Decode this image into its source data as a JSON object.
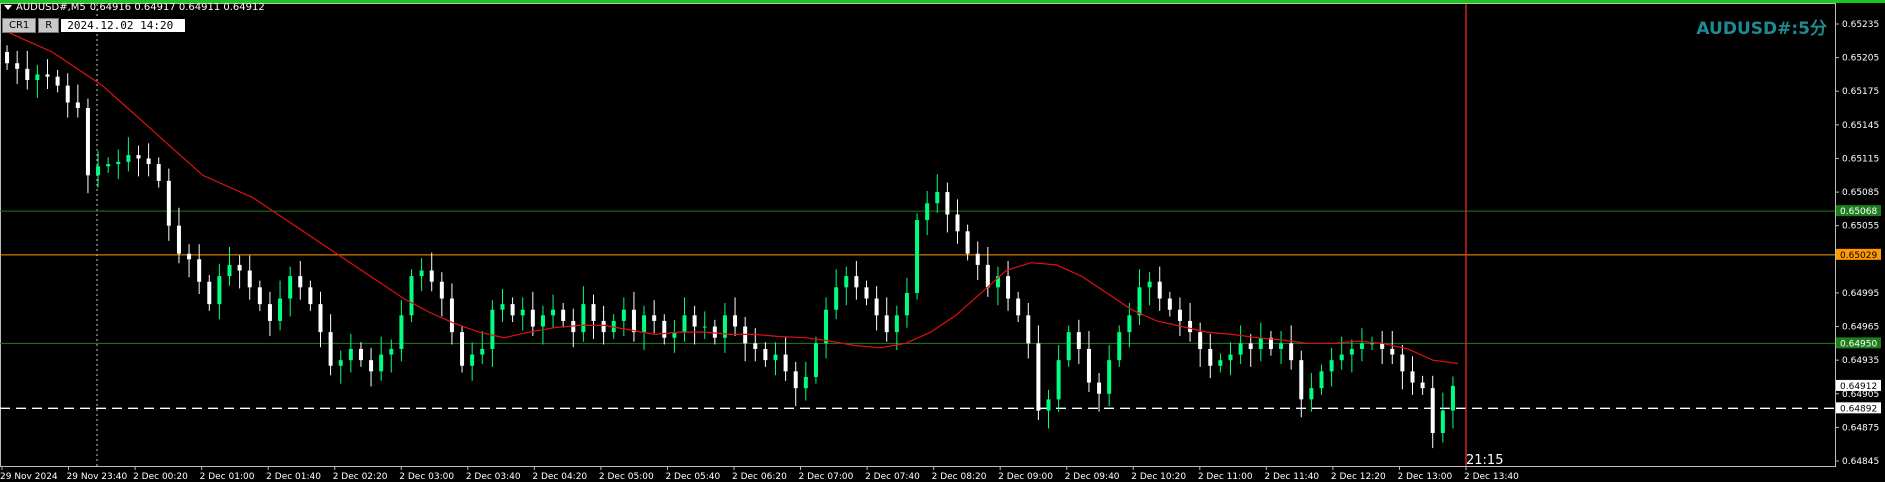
{
  "header": {
    "symbol_tf": "AUDUSD#,M5",
    "ohlc": "0.64916 0.64917 0.64911 0.64912"
  },
  "toolbar": {
    "btn1": "CR1",
    "btn2": "R",
    "datetime": "2024.12.02 14:20"
  },
  "watermark": "AUDUSD#:5分",
  "crosshair_time": "21:15",
  "colors": {
    "bg": "#000000",
    "bull": "#00ff7f",
    "bear": "#ffffff",
    "ma": "#ff2020",
    "hline_green": "#1e7e1e",
    "hline_orange": "#ff9900",
    "crosshair": "#ff2a2a"
  },
  "chart_data": {
    "type": "candlestick",
    "price_axis": {
      "min": 0.64845,
      "max": 0.65235,
      "ticks": [
        "0.65235",
        "0.65205",
        "0.65175",
        "0.65145",
        "0.65115",
        "0.65085",
        "0.65055",
        "0.64995",
        "0.64965",
        "0.64935",
        "0.64905",
        "0.64875",
        "0.64845"
      ]
    },
    "time_labels": [
      "29 Nov 2024",
      "29 Nov 23:40",
      "2 Dec 00:20",
      "2 Dec 01:00",
      "2 Dec 01:40",
      "2 Dec 02:20",
      "2 Dec 03:00",
      "2 Dec 03:40",
      "2 Dec 04:20",
      "2 Dec 05:00",
      "2 Dec 05:40",
      "2 Dec 06:20",
      "2 Dec 07:00",
      "2 Dec 07:40",
      "2 Dec 08:20",
      "2 Dec 09:00",
      "2 Dec 09:40",
      "2 Dec 10:20",
      "2 Dec 11:00",
      "2 Dec 11:40",
      "2 Dec 12:20",
      "2 Dec 13:00",
      "2 Dec 13:40"
    ],
    "horizontal_lines": [
      {
        "label": "0.65068",
        "price": 0.65068,
        "color": "#1e7e1e",
        "style": "solid"
      },
      {
        "label": "0.65029",
        "price": 0.65029,
        "color": "#ff9900",
        "style": "solid"
      },
      {
        "label": "0.64950",
        "price": 0.6495,
        "color": "#1e7e1e",
        "style": "solid"
      },
      {
        "label": "0.64892",
        "price": 0.64892,
        "color": "#ffffff",
        "style": "dashed"
      }
    ],
    "bid_label": "0.64912",
    "bid_price": 0.64912,
    "closes": [
      0.652,
      0.65195,
      0.65185,
      0.6519,
      0.65188,
      0.6518,
      0.65165,
      0.6516,
      0.651,
      0.65108,
      0.6511,
      0.65112,
      0.65118,
      0.65115,
      0.6511,
      0.65095,
      0.65055,
      0.6503,
      0.65025,
      0.65005,
      0.64985,
      0.6501,
      0.6502,
      0.65015,
      0.65,
      0.64985,
      0.6497,
      0.6499,
      0.6501,
      0.65,
      0.64985,
      0.6496,
      0.6493,
      0.64935,
      0.64945,
      0.64935,
      0.64925,
      0.6494,
      0.64945,
      0.64975,
      0.6501,
      0.65015,
      0.65005,
      0.6499,
      0.6496,
      0.6493,
      0.6494,
      0.64945,
      0.6498,
      0.64985,
      0.64975,
      0.6498,
      0.64965,
      0.64975,
      0.6498,
      0.6497,
      0.6496,
      0.64985,
      0.6497,
      0.6496,
      0.6497,
      0.6498,
      0.6496,
      0.64975,
      0.6497,
      0.64955,
      0.6496,
      0.64975,
      0.64965,
      0.64965,
      0.64955,
      0.64975,
      0.64965,
      0.6495,
      0.64945,
      0.64935,
      0.6494,
      0.64925,
      0.6491,
      0.6492,
      0.6495,
      0.6498,
      0.65,
      0.6501,
      0.65,
      0.6499,
      0.64975,
      0.6496,
      0.64975,
      0.64995,
      0.6506,
      0.65075,
      0.65085,
      0.65065,
      0.6505,
      0.6503,
      0.6502,
      0.65,
      0.6501,
      0.6499,
      0.64975,
      0.6495,
      0.6489,
      0.649,
      0.64935,
      0.6496,
      0.64945,
      0.64915,
      0.64905,
      0.64935,
      0.6496,
      0.64975,
      0.65,
      0.65005,
      0.6499,
      0.6498,
      0.6497,
      0.6496,
      0.64945,
      0.6493,
      0.64935,
      0.6494,
      0.6495,
      0.64945,
      0.64955,
      0.64945,
      0.6495,
      0.64935,
      0.649,
      0.6491,
      0.64925,
      0.64935,
      0.6494,
      0.64945,
      0.6495,
      0.6495,
      0.64945,
      0.6494,
      0.64925,
      0.64915,
      0.6491,
      0.6487,
      0.6489,
      0.64912
    ],
    "ma_values": [
      0.6523,
      0.6522,
      0.6521,
      0.65195,
      0.6518,
      0.6516,
      0.6514,
      0.6512,
      0.651,
      0.6509,
      0.6508,
      0.65065,
      0.6505,
      0.65035,
      0.6502,
      0.65005,
      0.6499,
      0.64978,
      0.64968,
      0.6496,
      0.64955,
      0.6496,
      0.64964,
      0.64966,
      0.64966,
      0.64962,
      0.64958,
      0.6496,
      0.6496,
      0.64958,
      0.64958,
      0.64956,
      0.64955,
      0.64952,
      0.64948,
      0.64946,
      0.6495,
      0.6496,
      0.64975,
      0.64995,
      0.65015,
      0.65022,
      0.6502,
      0.6501,
      0.64995,
      0.6498,
      0.6497,
      0.64965,
      0.6496,
      0.64958,
      0.64955,
      0.64953,
      0.6495,
      0.6495,
      0.64952,
      0.6495,
      0.64945,
      0.64935,
      0.64932
    ]
  }
}
